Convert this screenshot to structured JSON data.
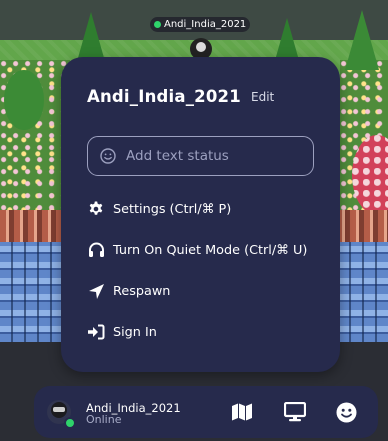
{
  "game": {
    "name_tag": "Andi_India_2021"
  },
  "popup": {
    "title": "Andi_India_2021",
    "edit_label": "Edit",
    "status_placeholder": "Add text status",
    "menu": [
      {
        "label": "Settings (Ctrl/⌘ P)",
        "icon": "gear-icon"
      },
      {
        "label": "Turn On Quiet Mode (Ctrl/⌘ U)",
        "icon": "headphones-icon"
      },
      {
        "label": "Respawn",
        "icon": "location-arrow-icon"
      },
      {
        "label": "Sign In",
        "icon": "sign-in-icon"
      }
    ]
  },
  "bottombar": {
    "name": "Andi_India_2021",
    "status": "Online",
    "buttons": [
      "map-icon",
      "screen-share-icon",
      "emoji-icon"
    ]
  },
  "colors": {
    "panel": "#262a4c",
    "online": "#2fd36b",
    "muted_text": "#9ca0bf"
  }
}
